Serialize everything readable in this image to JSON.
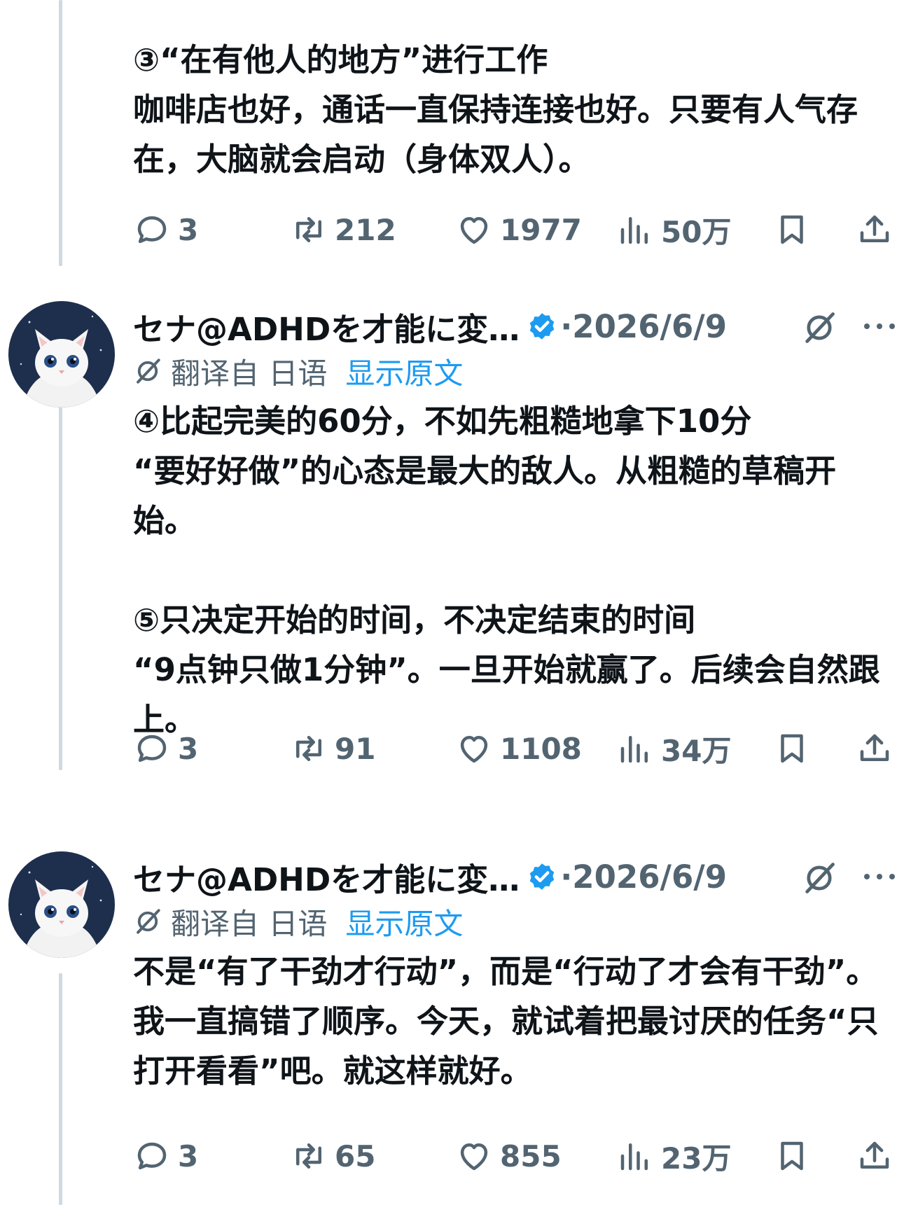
{
  "tweets": [
    {
      "body": "③“在有他人的地方”进行工作\n咖啡店也好，通话一直保持连接也好。只要有人气存在，大脑就会启动（身体双人）。",
      "stats": {
        "replies": "3",
        "retweets": "212",
        "likes": "1977",
        "views": "50万"
      }
    },
    {
      "author": "セナ@ADHDを才能に変…",
      "dot_date": "·2026/6/9",
      "translated_from": "翻译自 日语",
      "show_original": "显示原文",
      "body": "④比起完美的60分，不如先粗糙地拿下10分\n“要好好做”的心态是最大的敌人。从粗糙的草稿开始。\n\n⑤只决定开始的时间，不决定结束的时间\n“9点钟只做1分钟”。一旦开始就赢了。后续会自然跟上。",
      "stats": {
        "replies": "3",
        "retweets": "91",
        "likes": "1108",
        "views": "34万"
      }
    },
    {
      "author": "セナ@ADHDを才能に変…",
      "dot_date": "·2026/6/9",
      "translated_from": "翻译自 日语",
      "show_original": "显示原文",
      "body": "不是“有了干劲才行动”，而是“行动了才会有干劲”。我一直搞错了顺序。今天，就试着把最讨厌的任务“只打开看看”吧。就这样就好。",
      "stats": {
        "replies": "3",
        "retweets": "65",
        "likes": "855",
        "views": "23万"
      }
    }
  ],
  "colors": {
    "accent": "#1d9bf0",
    "muted": "#536471",
    "text": "#0f1419",
    "thread_line": "#cfd9de"
  },
  "icons": [
    "reply-icon",
    "retweet-icon",
    "like-icon",
    "views-icon",
    "bookmark-icon",
    "share-icon",
    "verified-icon",
    "grok-translate-icon",
    "more-icon"
  ]
}
